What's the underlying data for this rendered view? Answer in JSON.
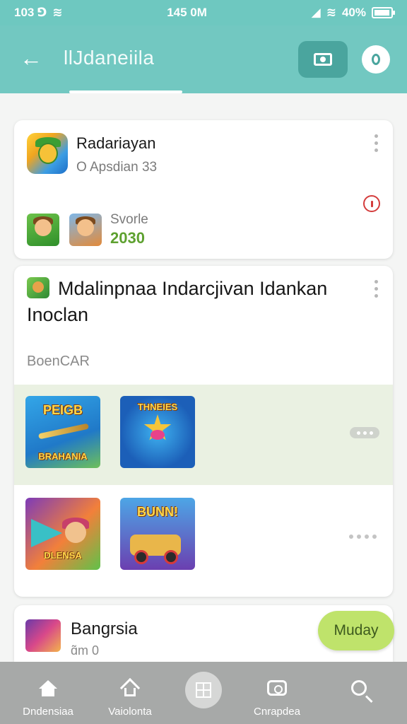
{
  "status_bar": {
    "left_text": "103 ⅁",
    "center_time": "145 0M",
    "right_text": "40%",
    "battery_level": 0.8
  },
  "app_bar": {
    "title": "llJdaneiila"
  },
  "card1": {
    "title": "Radariayan",
    "subtitle": "O Apsdian 33",
    "score_label": "Svorle",
    "score_value": "2030"
  },
  "card2": {
    "title": "Mdalinpnaa Indarcjivan Idankan Inoclan",
    "section_label": "BoenCAR",
    "tiles": [
      {
        "top": "PEIGB",
        "bottom": "BRAHANIA"
      },
      {
        "top": "THNEIES",
        "bottom": ""
      },
      {
        "top": "",
        "bottom": "DLENSA"
      },
      {
        "top": "BUNN!",
        "bottom": ""
      }
    ]
  },
  "card3": {
    "title": "Bangrsia",
    "subtitle": "ɑ̃m 0",
    "action_label": "Muday"
  },
  "bottom_nav": {
    "items": [
      {
        "label": "Dndensiaa"
      },
      {
        "label": "Vaiolonta"
      },
      {
        "label": ""
      },
      {
        "label": "Cnrapdea"
      },
      {
        "label": ""
      }
    ]
  },
  "colors": {
    "app_bar": "#72c8c1",
    "accent_green": "#5ea130",
    "action_button": "#bfe36b",
    "alert_red": "#d43c3c"
  },
  "icons": [
    "back-arrow-icon",
    "camera-icon",
    "location-pin-icon",
    "more-vertical-icon",
    "alert-icon",
    "home-icon",
    "store-icon",
    "grid-icon",
    "media-icon",
    "search-icon"
  ]
}
